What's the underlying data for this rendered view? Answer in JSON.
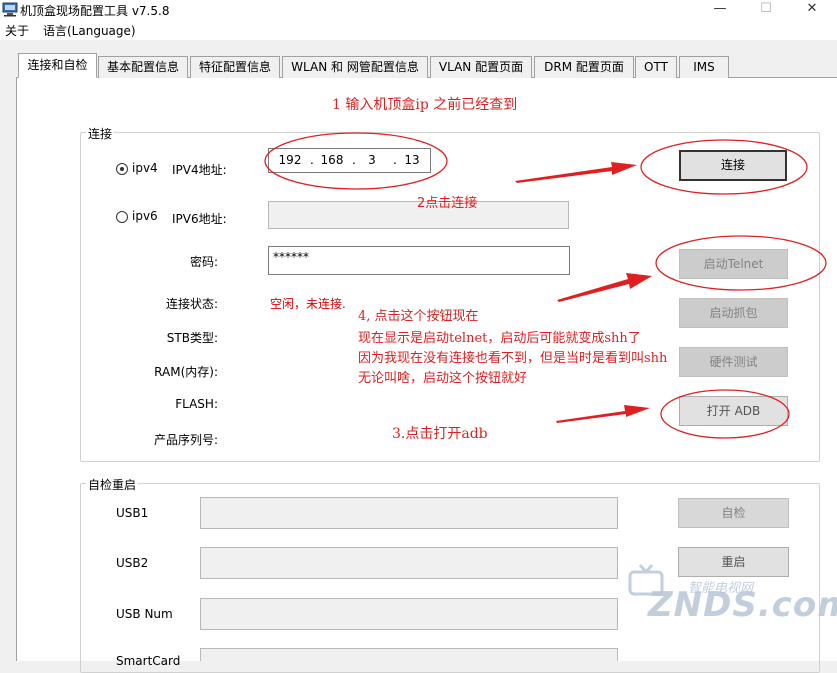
{
  "window": {
    "title": "机顶盒现场配置工具 v7.5.8",
    "minimize": "—",
    "maximize": "☐",
    "close": "✕"
  },
  "menu": {
    "about": "关于",
    "language": "语言(Language)"
  },
  "tabs": [
    {
      "label": "连接和自检",
      "active": true
    },
    {
      "label": "基本配置信息"
    },
    {
      "label": "特征配置信息"
    },
    {
      "label": "WLAN 和 网管配置信息"
    },
    {
      "label": "VLAN 配置页面"
    },
    {
      "label": "DRM 配置页面"
    },
    {
      "label": "OTT"
    },
    {
      "label": "IMS"
    }
  ],
  "connection": {
    "group_title": "连接",
    "ipv4_radio": "ipv4",
    "ipv4_label": "IPV4地址:",
    "ipv4_parts": [
      "192",
      "168",
      "3",
      "13"
    ],
    "ipv6_radio": "ipv6",
    "ipv6_label": "IPV6地址:",
    "ipv6_value": "",
    "password_label": "密码:",
    "password_value": "******",
    "status_label": "连接状态:",
    "status_value": "空闲，未连接.",
    "stb_type_label": "STB类型:",
    "ram_label": "RAM(内存):",
    "flash_label": "FLASH:",
    "serial_label": "产品序列号:",
    "connect_button": "连接",
    "telnet_button": "启动Telnet",
    "capture_button": "启动抓包",
    "hwtest_button": "硬件测试",
    "adb_button": "打开 ADB"
  },
  "selfcheck": {
    "group_title": "自检重启",
    "usb1_label": "USB1",
    "usb2_label": "USB2",
    "usbnum_label": "USB Num",
    "smartcard_label": "SmartCard",
    "selfcheck_button": "自检",
    "restart_button": "重启"
  },
  "annotations": {
    "note1": "1 输入机顶盒ip 之前已经查到",
    "note2": "2点击连接",
    "note3": "3.点击打开adb",
    "note4_line1": "4, 点击这个按钮现在",
    "note4_line2": "现在显示是启动telnet，启动后可能就变成shh了",
    "note4_line3": "因为我现在没有连接也看不到，但是当时是看到叫shh",
    "note4_line4": "无论叫啥，启动这个按钮就好",
    "color": "#e02020"
  },
  "watermark": {
    "top": "智能电视网",
    "main": "ZNDS.com"
  },
  "colors": {
    "window_bg": "#f0f0f0",
    "page_bg": "#ffffff",
    "annotation": "#e02020",
    "status": "#e00000"
  }
}
